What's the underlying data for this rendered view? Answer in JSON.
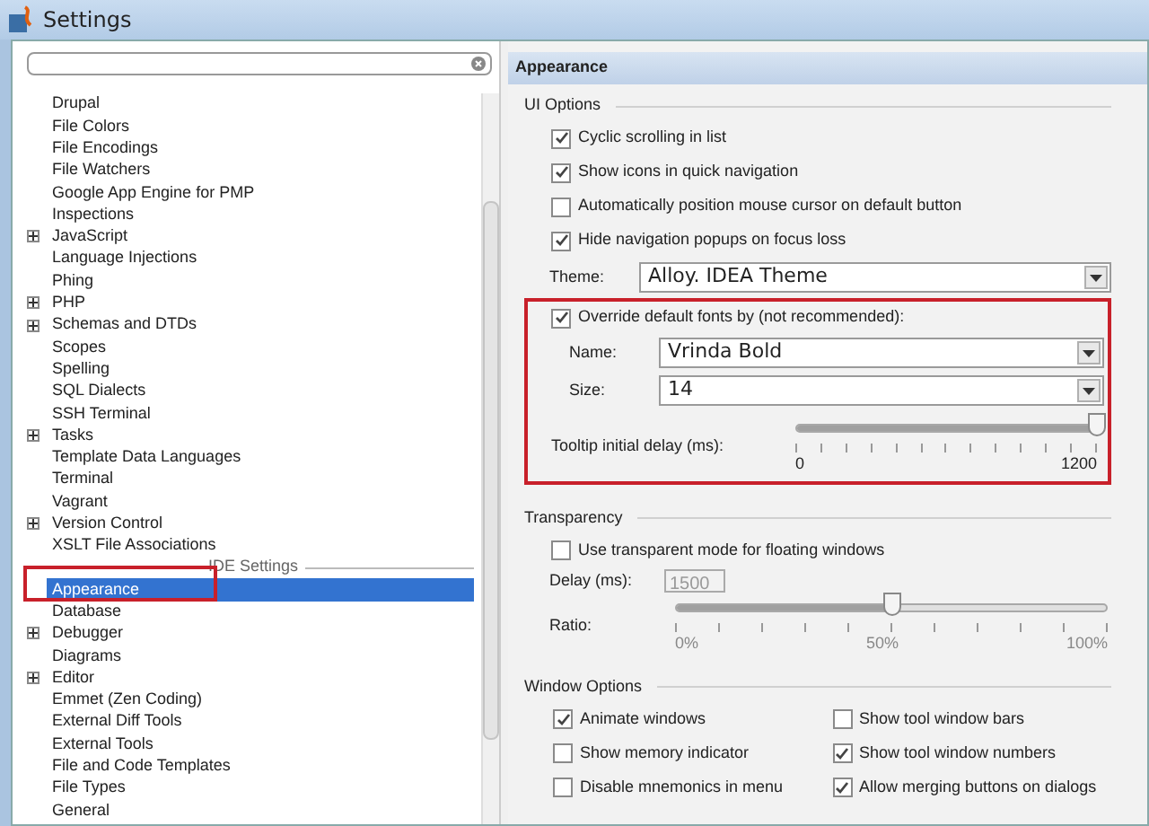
{
  "window": {
    "title": "Settings"
  },
  "tree": {
    "items": [
      {
        "kind": "item",
        "label": "Drupal",
        "expandable": false,
        "selected": false
      },
      {
        "kind": "item",
        "label": "File Colors",
        "expandable": false,
        "selected": false
      },
      {
        "kind": "item",
        "label": "File Encodings",
        "expandable": false,
        "selected": false
      },
      {
        "kind": "item",
        "label": "File Watchers",
        "expandable": false,
        "selected": false
      },
      {
        "kind": "item",
        "label": "Google App Engine for PMP",
        "expandable": false,
        "selected": false
      },
      {
        "kind": "item",
        "label": "Inspections",
        "expandable": false,
        "selected": false
      },
      {
        "kind": "item",
        "label": "JavaScript",
        "expandable": true,
        "selected": false
      },
      {
        "kind": "item",
        "label": "Language Injections",
        "expandable": false,
        "selected": false
      },
      {
        "kind": "item",
        "label": "Phing",
        "expandable": false,
        "selected": false
      },
      {
        "kind": "item",
        "label": "PHP",
        "expandable": true,
        "selected": false
      },
      {
        "kind": "item",
        "label": "Schemas and DTDs",
        "expandable": true,
        "selected": false
      },
      {
        "kind": "item",
        "label": "Scopes",
        "expandable": false,
        "selected": false
      },
      {
        "kind": "item",
        "label": "Spelling",
        "expandable": false,
        "selected": false
      },
      {
        "kind": "item",
        "label": "SQL Dialects",
        "expandable": false,
        "selected": false
      },
      {
        "kind": "item",
        "label": "SSH Terminal",
        "expandable": false,
        "selected": false
      },
      {
        "kind": "item",
        "label": "Tasks",
        "expandable": true,
        "selected": false
      },
      {
        "kind": "item",
        "label": "Template Data Languages",
        "expandable": false,
        "selected": false
      },
      {
        "kind": "item",
        "label": "Terminal",
        "expandable": false,
        "selected": false
      },
      {
        "kind": "item",
        "label": "Vagrant",
        "expandable": false,
        "selected": false
      },
      {
        "kind": "item",
        "label": "Version Control",
        "expandable": true,
        "selected": false
      },
      {
        "kind": "item",
        "label": "XSLT File Associations",
        "expandable": false,
        "selected": false
      },
      {
        "kind": "separator",
        "label": "IDE Settings"
      },
      {
        "kind": "item",
        "label": "Appearance",
        "expandable": false,
        "selected": true
      },
      {
        "kind": "item",
        "label": "Database",
        "expandable": false,
        "selected": false
      },
      {
        "kind": "item",
        "label": "Debugger",
        "expandable": true,
        "selected": false
      },
      {
        "kind": "item",
        "label": "Diagrams",
        "expandable": false,
        "selected": false
      },
      {
        "kind": "item",
        "label": "Editor",
        "expandable": true,
        "selected": false
      },
      {
        "kind": "item",
        "label": "Emmet (Zen Coding)",
        "expandable": false,
        "selected": false
      },
      {
        "kind": "item",
        "label": "External Diff Tools",
        "expandable": false,
        "selected": false
      },
      {
        "kind": "item",
        "label": "External Tools",
        "expandable": false,
        "selected": false
      },
      {
        "kind": "item",
        "label": "File and Code Templates",
        "expandable": false,
        "selected": false
      },
      {
        "kind": "item",
        "label": "File Types",
        "expandable": false,
        "selected": false
      },
      {
        "kind": "item",
        "label": "General",
        "expandable": false,
        "selected": false
      }
    ]
  },
  "panel": {
    "title": "Appearance",
    "ui_options": {
      "title": "UI Options",
      "checkboxes": [
        {
          "label": "Cyclic scrolling in list",
          "checked": true
        },
        {
          "label": "Show icons in quick navigation",
          "checked": true
        },
        {
          "label": "Automatically position mouse cursor on default button",
          "checked": false
        },
        {
          "label": "Hide navigation popups on focus loss",
          "checked": true
        }
      ],
      "theme": {
        "label": "Theme:",
        "value": "Alloy. IDEA Theme"
      },
      "override": {
        "label": "Override default fonts by (not recommended):",
        "checked": true,
        "name": {
          "label": "Name:",
          "value": "Vrinda Bold"
        },
        "size": {
          "label": "Size:",
          "value": "14"
        }
      },
      "tooltip": {
        "label": "Tooltip initial delay (ms):",
        "level": 1,
        "min": "0",
        "max": "1200"
      }
    },
    "transparency": {
      "title": "Transparency",
      "checkbox": {
        "label": "Use transparent mode for floating windows",
        "checked": false
      },
      "delay": {
        "label": "Delay (ms):",
        "value": "1500",
        "disabled": true
      },
      "ratio": {
        "label": "Ratio:",
        "level": 0.5,
        "ticks": [
          "0%",
          "50%",
          "100%"
        ]
      }
    },
    "window_options": {
      "title": "Window Options",
      "checkboxes": [
        {
          "label": "Animate windows",
          "checked": true
        },
        {
          "label": "Show tool window bars",
          "checked": false
        },
        {
          "label": "Show memory indicator",
          "checked": false
        },
        {
          "label": "Show tool window numbers",
          "checked": true
        },
        {
          "label": "Disable mnemonics in menu",
          "checked": false
        },
        {
          "label": "Allow merging buttons on dialogs",
          "checked": true
        }
      ]
    }
  }
}
